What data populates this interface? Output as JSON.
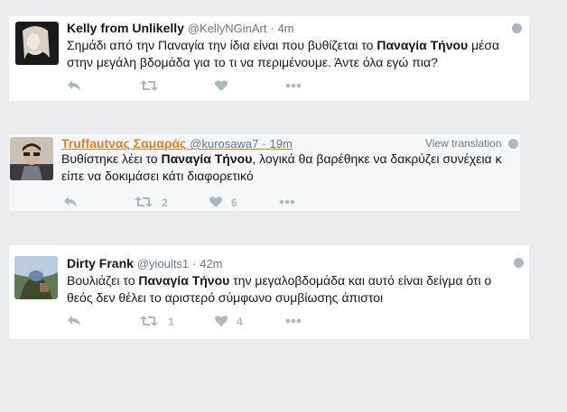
{
  "tweets": [
    {
      "name": "Kelly from Unlikelly",
      "handle": "@KellyNGinArt",
      "sep": "·",
      "time": "4m",
      "text_a": "Σημάδι από την Παναγία την ίδια είναι που βυθίζεται το ",
      "text_bold": "Παναγία Τήνου",
      "text_b": " μέσα στην μεγάλη βδομάδα για το τι να περιμένουμε. Άντε όλα εγώ πια?",
      "retweets": "",
      "likes": ""
    },
    {
      "name": "Truffautνας Σαμαράς",
      "handle": "@kurosawa7",
      "sep": "·",
      "time": "19m",
      "view_translation": "View translation",
      "text_a": "Βυθίστηκε λέει το ",
      "text_bold": "Παναγία Τήνου",
      "text_b": ", λογικά θα βαρέθηκε να δακρύζει συνέχεια κ είπε να δοκιμάσει κάτι διαφορετικό",
      "retweets": "2",
      "likes": "6"
    },
    {
      "name": "Dirty Frank",
      "handle": "@yioults1",
      "sep": "·",
      "time": "42m",
      "text_a": "Βουλιάζει το ",
      "text_bold": "Παναγία Τήνου",
      "text_b": " την μεγαλοβδομάδα και αυτό είναι δείγμα ότι ο θεός δεν θέλει το αριστερό σύμφωνο συμβίωσης άπιστοι",
      "retweets": "1",
      "likes": "4"
    }
  ],
  "colors": {
    "background": "#e9ebee",
    "card": "#ffffff",
    "highlight_card": "#f5f8fa",
    "name_link": "#e27e1b",
    "muted": "#657786",
    "icon": "#aab8c2"
  },
  "icons": [
    "reply-icon",
    "retweet-icon",
    "like-icon",
    "more-icon",
    "globe-icon"
  ]
}
